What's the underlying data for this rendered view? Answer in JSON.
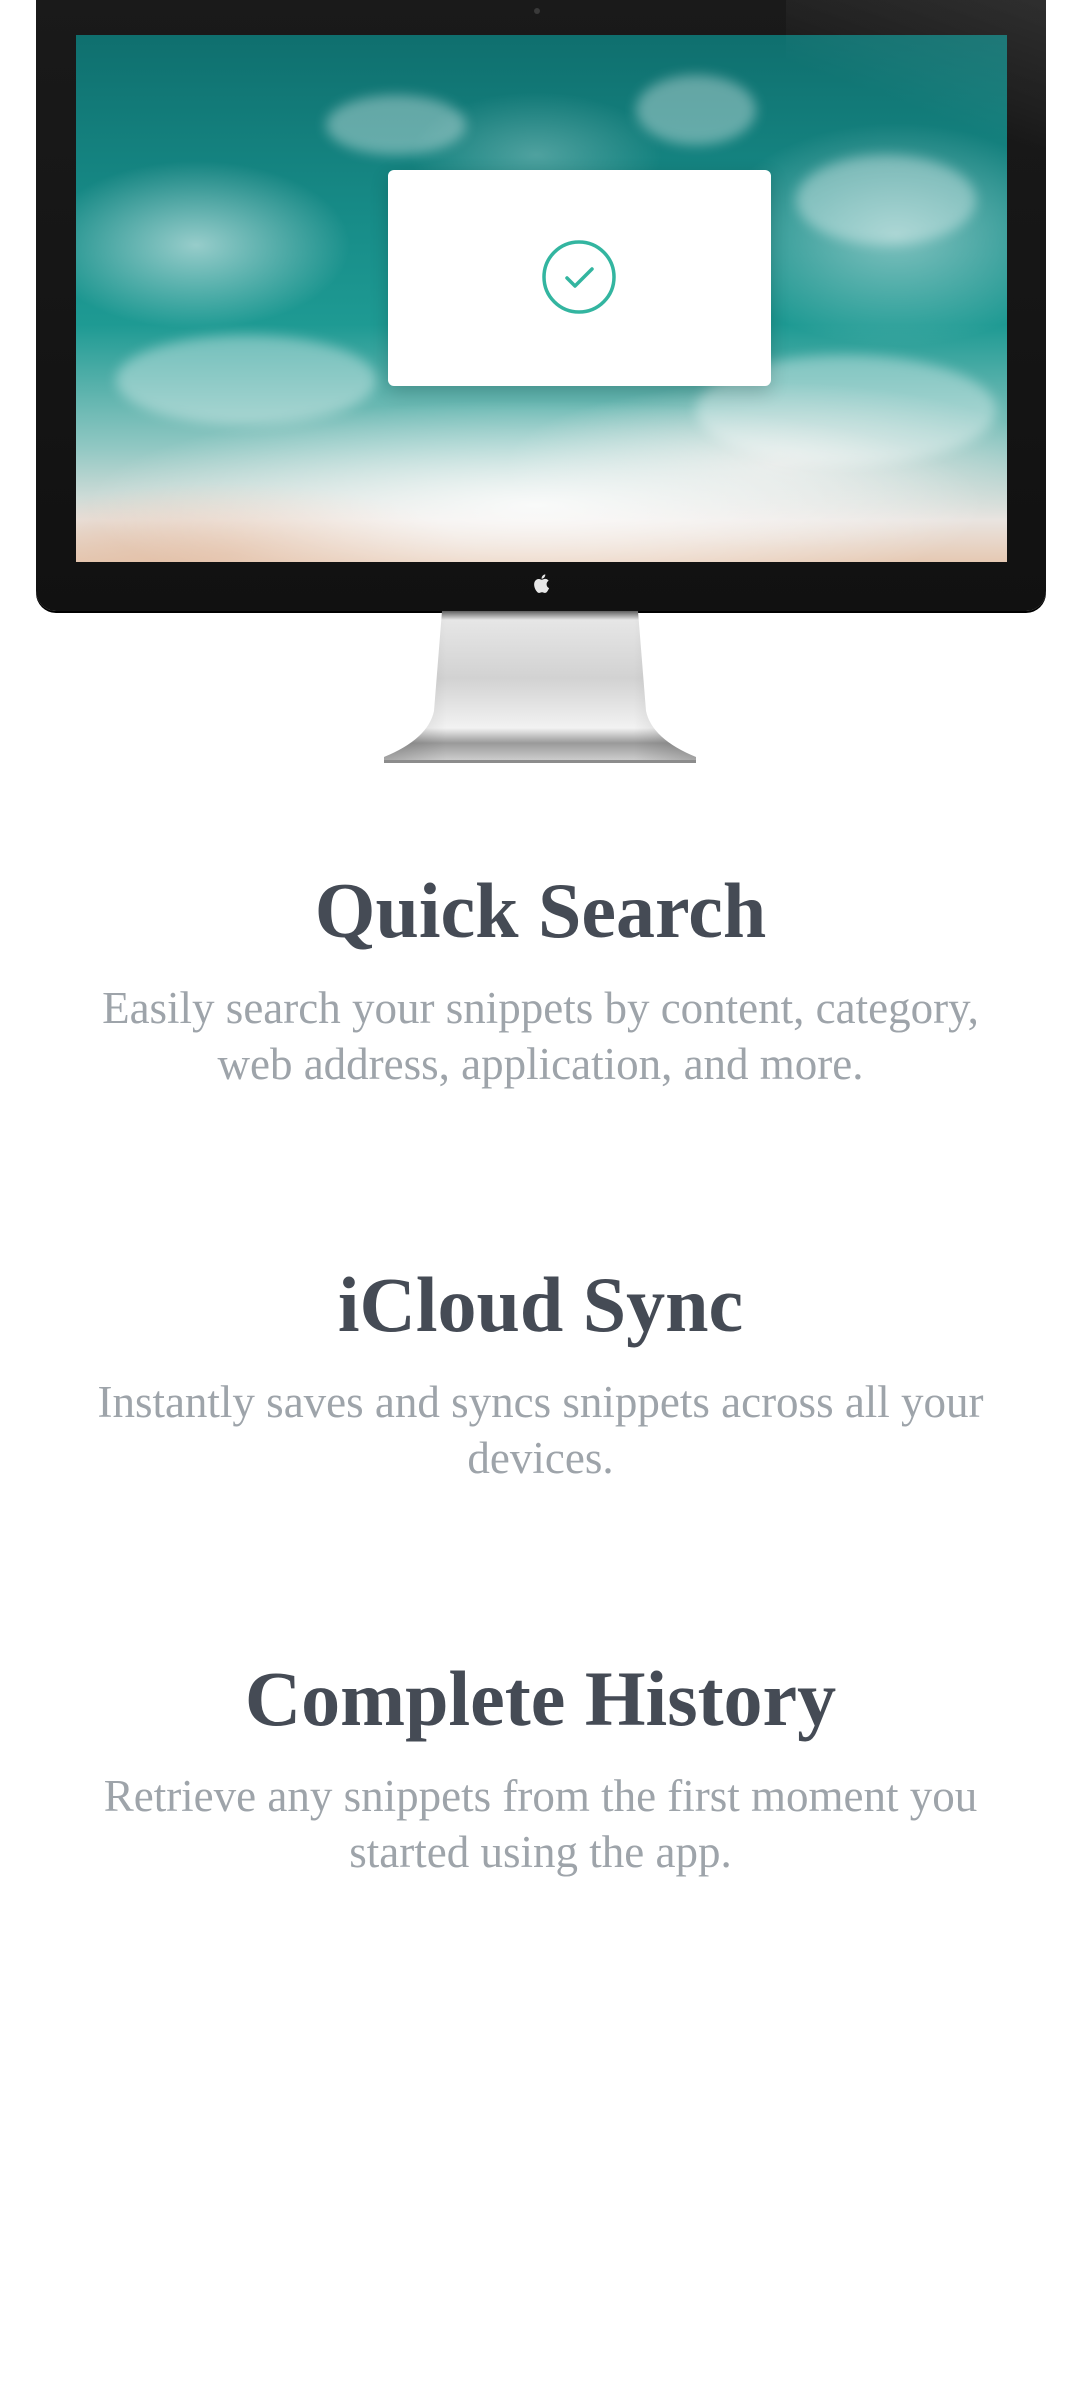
{
  "hero": {
    "screen_image": "ocean-waves-aerial",
    "dialog_icon": "checkmark-circle-icon",
    "logo_icon": "apple-logo-icon",
    "accent_color": "#33b5a0"
  },
  "features": [
    {
      "title": "Quick Search",
      "description": "Easily search your snippets by content, category, web address, application, and more."
    },
    {
      "title": "iCloud Sync",
      "description": "Instantly saves and syncs snippets across all your devices."
    },
    {
      "title": "Complete History",
      "description": "Retrieve any snippets from the first moment you started using the app."
    }
  ]
}
